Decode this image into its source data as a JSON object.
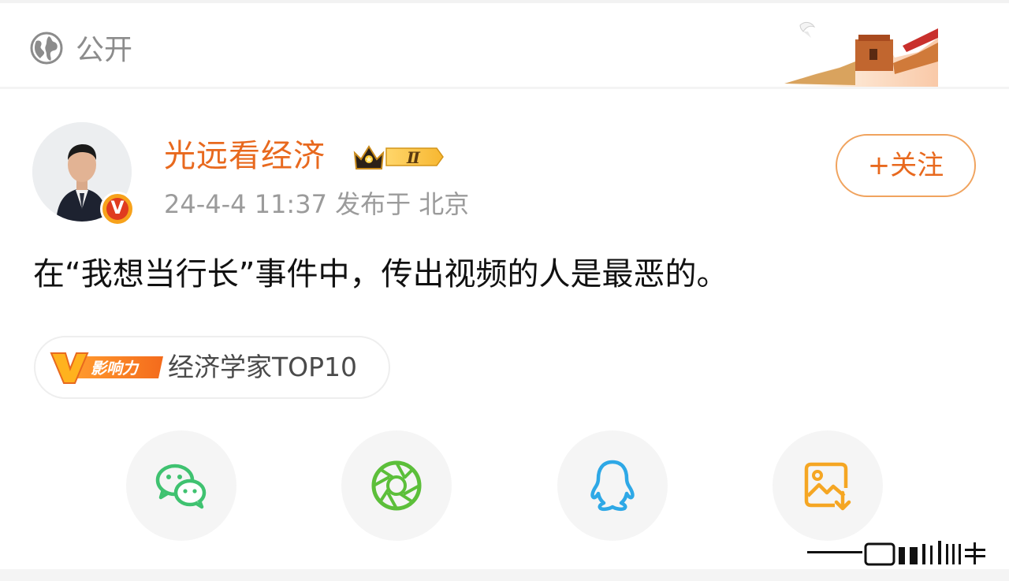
{
  "header": {
    "visibility_label": "公开",
    "globe_icon": "globe-icon"
  },
  "post": {
    "author": "光远看经济",
    "verified_icon": "verified-v-icon",
    "member_badge": "Ⅱ",
    "timestamp": "24-4-4 11:37",
    "location": "发布于 北京",
    "follow_label": "+关注",
    "content": "在“我想当行长”事件中，传出视频的人是最恶的。"
  },
  "influence_tag": {
    "badge_label": "影响力",
    "text": "经济学家TOP10"
  },
  "share_targets": [
    {
      "icon": "wechat-icon",
      "color": "#3fc270"
    },
    {
      "icon": "moments-icon",
      "color": "#5cbf3a"
    },
    {
      "icon": "qq-icon",
      "color": "#2ea8e6"
    },
    {
      "icon": "save-image-icon",
      "color": "#f5a623"
    }
  ],
  "colors": {
    "accent": "#e8691e",
    "follow_border": "#f0a35e",
    "meta_text": "#9b9b9b",
    "background": "#ffffff"
  }
}
